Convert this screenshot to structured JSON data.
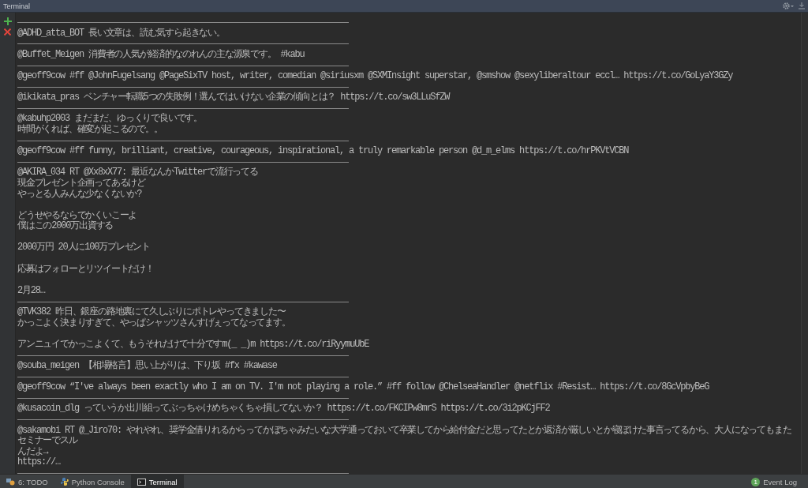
{
  "window": {
    "title": "Terminal"
  },
  "entries": [
    {
      "paragraphs": [
        [
          "@ADHD_atta_BOT 長い文章は、読む気すら起きない。"
        ]
      ]
    },
    {
      "paragraphs": [
        [
          "@Buffet_Meigen 消費者の人気が経済的なのれんの主な源泉です。 #kabu"
        ]
      ]
    },
    {
      "paragraphs": [
        [
          "@geoff9cow #ff @JohnFugelsang @PageSixTV host, writer, comedian @siriusxm @SXMInsight superstar, @smshow @sexyliberaltour eccl… https://t.co/GoLyaY3GZy"
        ]
      ]
    },
    {
      "paragraphs": [
        [
          "@ikikata_pras ベンチャー転職5つの失敗例！選んではいけない企業の傾向とは？ https://t.co/sw3LLuSfZW"
        ]
      ]
    },
    {
      "paragraphs": [
        [
          "@kabuhp2003 まだまだ、ゆっくりで良いです。",
          "時間がくれば、確変が起こるので。。"
        ]
      ]
    },
    {
      "paragraphs": [
        [
          "@geoff9cow #ff funny, brilliant, creative, courageous, inspirational, a truly remarkable person @d_m_elms https://t.co/hrPKVtVCBN"
        ]
      ]
    },
    {
      "paragraphs": [
        [
          "@AKIRA_034 RT @Xx8xX77: 最近なんかTwitterで流行ってる",
          "現金プレゼント企画ってあるけど",
          "やっとる人みんな少なくないか?"
        ],
        [
          "どうせやるならでかくいこーよ",
          "僕はこの2000万出資する"
        ],
        [
          "2000万円 20人に100万プレゼント"
        ],
        [
          "応募はフォローとリツイートだけ！"
        ],
        [
          "2月28…"
        ]
      ]
    },
    {
      "paragraphs": [
        [
          "@TVK382 昨日、銀座の路地裏にて久しぶりにポトレやってきました〜",
          "かっこよく決まりすぎて、やっぱシャッツさんすげぇってなってます。"
        ],
        [
          "アンニュイでかっこよくて、もうそれだけで十分ですm(_ _)m https://t.co/riRyymuUbE"
        ]
      ]
    },
    {
      "paragraphs": [
        [
          "@souba_meigen 【相場格言】思い上がりは、下り坂 #fx #kawase"
        ]
      ]
    },
    {
      "paragraphs": [
        [
          "@geoff9cow “I've always been exactly who I am on TV. I'm not playing a role.” #ff follow @ChelseaHandler @netflix #Resist… https://t.co/8GcVpbyBeG"
        ]
      ]
    },
    {
      "paragraphs": [
        [
          "@kusacoin_dlg っていうか出川組ってぶっちゃけめちゃくちゃ損してないか？ https://t.co/FKCIPw8mrS https://t.co/3i2pKCjFF2"
        ]
      ]
    },
    {
      "paragraphs": [
        [
          "@sakamobi RT @_Jiro70: やれやれ、奨学金借りれるからってかぼちゃみたいな大学通っておいて卒業してから給付金だと思ってたとか返済が厳しいとか寝ぼけた事言ってるから、大人になってもまたセミナーでスル",
          "んだよ→",
          "https://…"
        ]
      ]
    }
  ],
  "bottom_tabs": [
    {
      "label": "6: TODO",
      "kind": "todo",
      "selected": false
    },
    {
      "label": "Python Console",
      "kind": "python",
      "selected": false
    },
    {
      "label": "Terminal",
      "kind": "terminal",
      "selected": true
    }
  ],
  "event_log": {
    "label": "Event Log",
    "badge": "1"
  }
}
